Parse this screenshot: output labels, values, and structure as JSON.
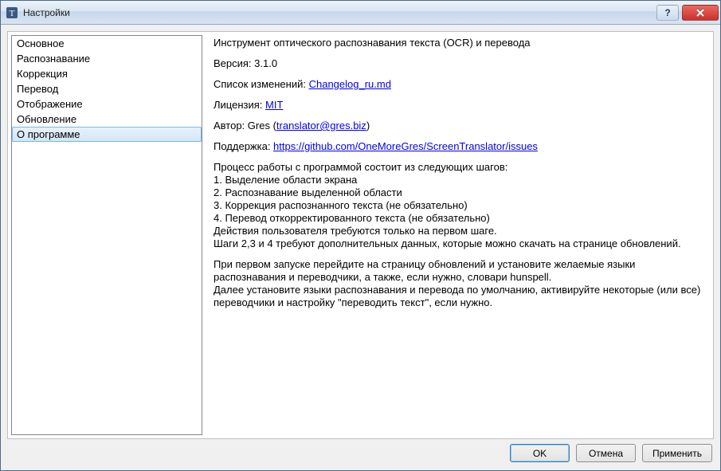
{
  "window": {
    "title": "Настройки"
  },
  "sidebar": {
    "items": [
      {
        "label": "Основное"
      },
      {
        "label": "Распознавание"
      },
      {
        "label": "Коррекция"
      },
      {
        "label": "Перевод"
      },
      {
        "label": "Отображение"
      },
      {
        "label": "Обновление"
      },
      {
        "label": "О программе"
      }
    ],
    "selectedIndex": 6
  },
  "about": {
    "heading": "Инструмент оптического распознавания текста (OCR) и перевода",
    "version_label": "Версия: ",
    "version": "3.1.0",
    "changelog_label": "Список изменений: ",
    "changelog_link": "Changelog_ru.md",
    "license_label": "Лицензия: ",
    "license_link": "MIT",
    "author_label": "Автор: Gres (",
    "author_link": "translator@gres.biz",
    "author_tail": ")",
    "support_label": "Поддержка: ",
    "support_link": "https://github.com/OneMoreGres/ScreenTranslator/issues",
    "steps": "Процесс работы с программой состоит из следующих шагов:\n1. Выделение области экрана\n2. Распознавание выделенной области\n3. Коррекция распознанного текста (не обязательно)\n4. Перевод откорректированного текста (не обязательно)\nДействия пользователя требуются только на первом шаге.\nШаги 2,3 и 4 требуют дополнительных данных, которые можно скачать на странице обновлений.",
    "first_run": "При первом запуске перейдите на страницу обновлений и установите желаемые языки распознавания и переводчики, а также, если нужно, словари hunspell.\nДалее установите языки распознавания и перевода по умолчанию, активируйте некоторые (или все) переводчики и настройку \"переводить текст\", если нужно."
  },
  "buttons": {
    "ok": "OK",
    "cancel": "Отмена",
    "apply": "Применить"
  }
}
